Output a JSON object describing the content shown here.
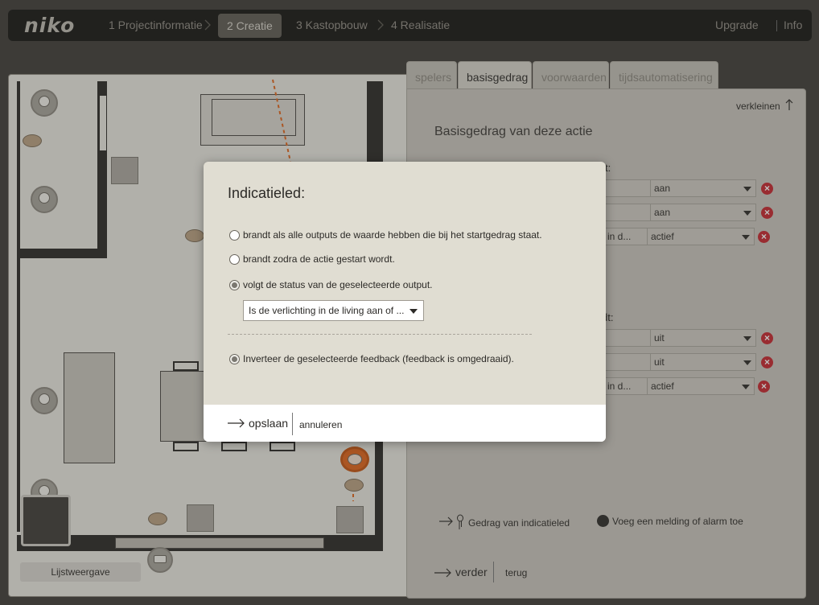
{
  "topbar": {
    "logo": "niko",
    "steps": [
      "1 Projectinformatie",
      "2 Creatie",
      "3 Kastopbouw",
      "4 Realisatie"
    ],
    "upgrade": "Upgrade",
    "info": "Info"
  },
  "plan": {
    "list_view": "Lijstweergave"
  },
  "panel": {
    "tabs": [
      "spelers",
      "basisgedrag",
      "voorwaarden",
      "tijdsautomatisering"
    ],
    "active_tab": "basisgedrag",
    "collapse": "verkleinen",
    "title": "Basisgedrag van deze actie",
    "fragment_top": "t:",
    "fragment_bottom": "dt:",
    "rows_top": [
      {
        "left": "",
        "value": "aan"
      },
      {
        "left": "",
        "value": "aan"
      },
      {
        "left": "g in d...",
        "value": "actief"
      }
    ],
    "rows_bottom": [
      {
        "left": "",
        "value": "uit"
      },
      {
        "left": "",
        "value": "uit"
      },
      {
        "left": "g in d...",
        "value": "actief"
      }
    ],
    "indicator_link": "Gedrag van indicatieled",
    "alarm_link": "Voeg een melding of alarm toe",
    "next": "verder",
    "back": "terug"
  },
  "dialog": {
    "title": "Indicatieled:",
    "options": [
      {
        "label": "brandt als alle outputs de waarde hebben die bij het startgedrag staat.",
        "selected": false
      },
      {
        "label": "brandt zodra de actie gestart wordt.",
        "selected": false
      },
      {
        "label": "volgt de status van de geselecteerde output.",
        "selected": true
      }
    ],
    "output_select": "Is de verlichting in de living aan of ...",
    "invert": {
      "label": "Inverteer de geselecteerde feedback (feedback is omgedraaid).",
      "selected": true
    },
    "save": "opslaan",
    "cancel": "annuleren"
  },
  "colors": {
    "accent_orange": "#e0641a",
    "remove_red": "#c6262e"
  }
}
